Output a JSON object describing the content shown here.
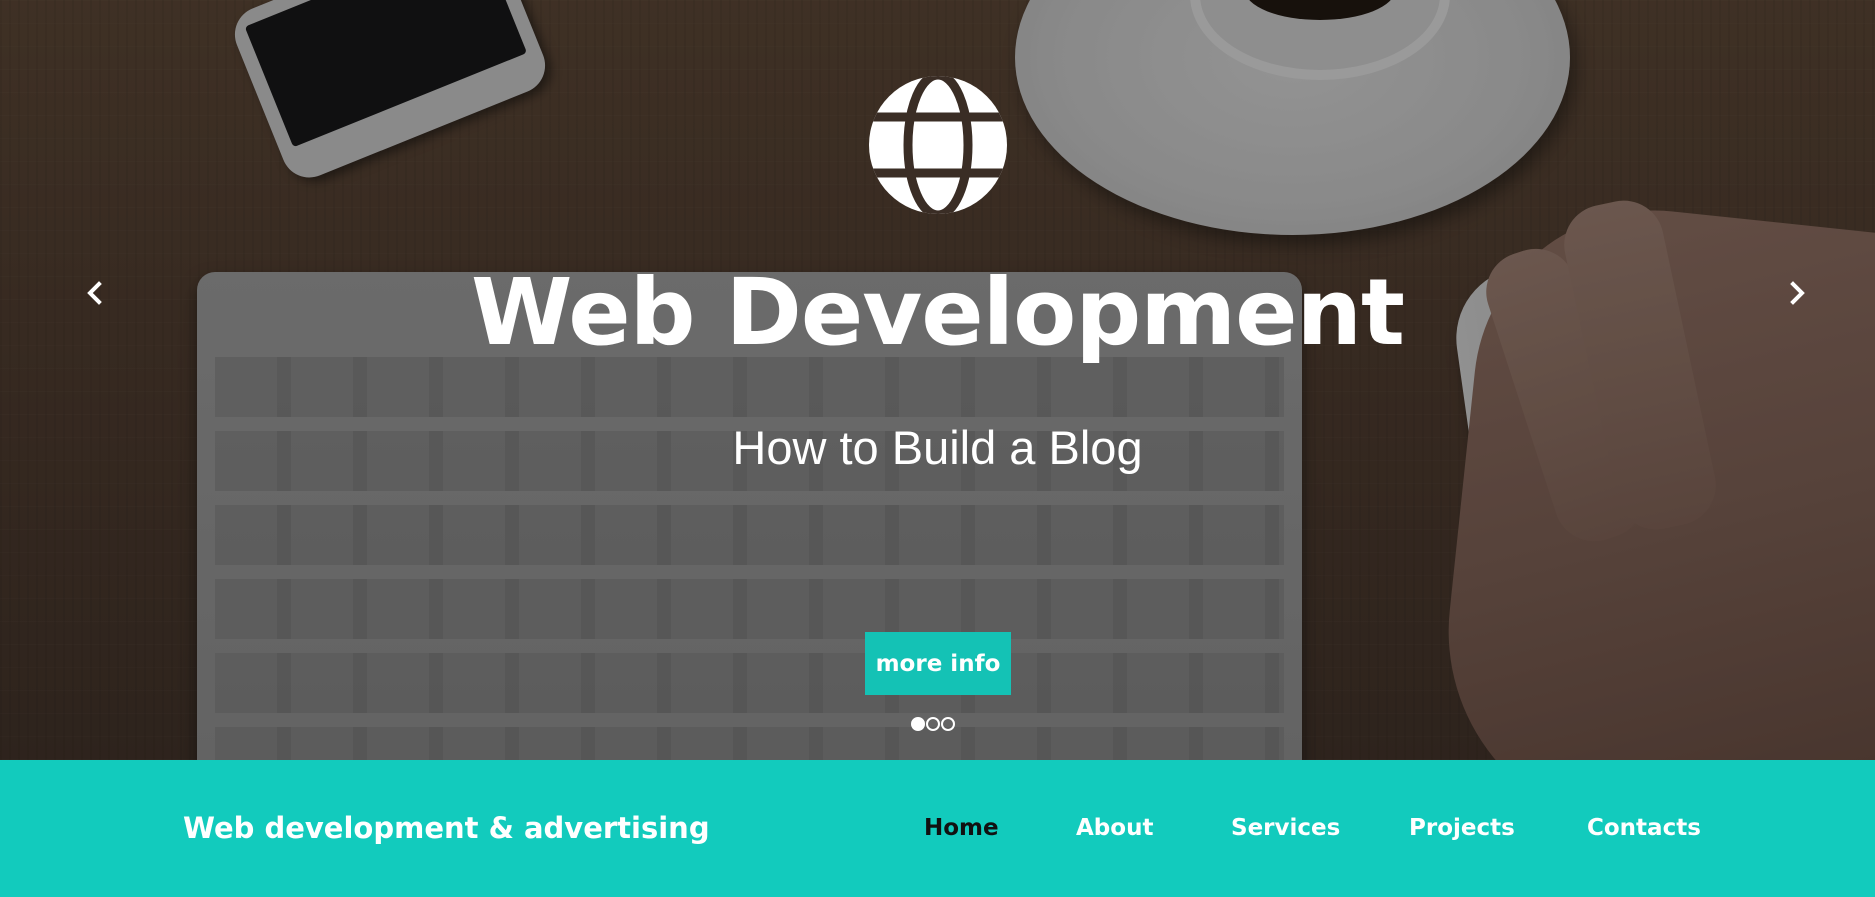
{
  "hero": {
    "title": "Web Development",
    "subtitle": "How to Build a Blog",
    "cta_label": "more info",
    "slides_total": 3,
    "active_slide": 1,
    "icon": "globe-icon",
    "prev_icon": "chevron-left-icon",
    "next_icon": "chevron-right-icon"
  },
  "navbar": {
    "brand": "Web development & advertising",
    "items": [
      {
        "label": "Home",
        "active": true
      },
      {
        "label": "About",
        "active": false
      },
      {
        "label": "Services",
        "active": false
      },
      {
        "label": "Projects",
        "active": false
      },
      {
        "label": "Contacts",
        "active": false
      }
    ]
  },
  "colors": {
    "accent": "#12cbbd",
    "button": "#14c2b5",
    "active_nav": "#111111",
    "text": "#ffffff"
  }
}
